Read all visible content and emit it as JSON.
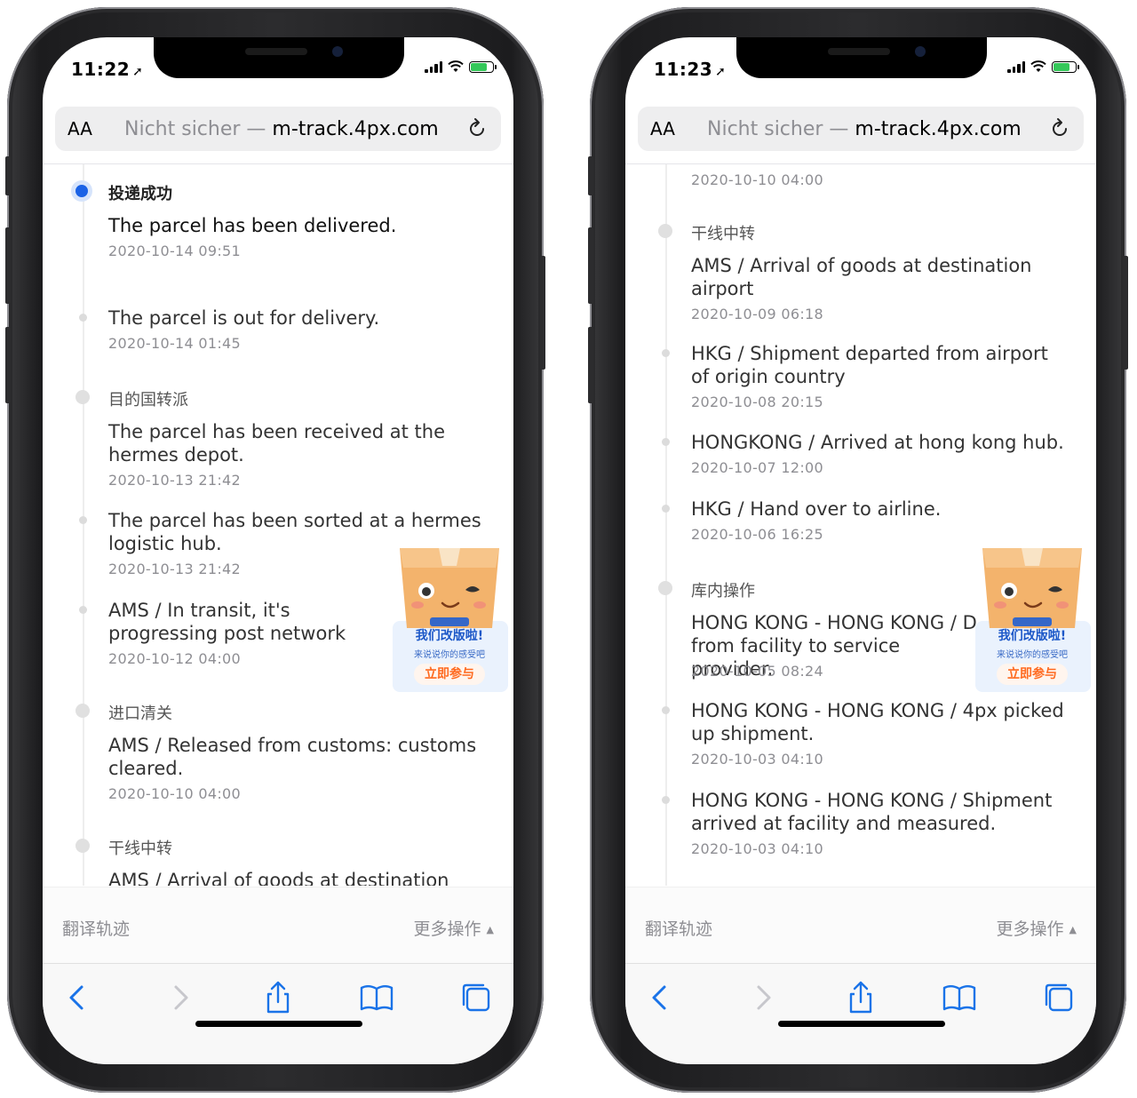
{
  "left": {
    "status_time": "11:22",
    "url_aa": "AA",
    "url_prefix": "Nicht sicher — ",
    "url_domain": "m-track.4px.com",
    "events": [
      {
        "status": "投递成功",
        "desc": "The parcel has been delivered.",
        "time": "2020-10-14 09:51",
        "dot": "active"
      },
      {
        "desc": "The parcel is out for delivery.",
        "time": "2020-10-14 01:45",
        "dot": "small"
      },
      {
        "status": "目的国转派",
        "desc": "The parcel has been received at the hermes depot.",
        "time": "2020-10-13 21:42",
        "dot": "big"
      },
      {
        "desc": "The parcel has been sorted at a hermes logistic hub.",
        "time": "2020-10-13 21:42",
        "dot": "small"
      },
      {
        "desc": "AMS / In transit, it's progressing post network",
        "time": "2020-10-12 04:00",
        "dot": "small"
      },
      {
        "status": "进口清关",
        "desc": "AMS / Released from customs: customs cleared.",
        "time": "2020-10-10 04:00",
        "dot": "big"
      },
      {
        "status": "干线中转",
        "desc": "AMS / Arrival of goods at destination airport",
        "dot": "big"
      }
    ],
    "bottom": {
      "translate": "翻译轨迹",
      "more": "更多操作"
    }
  },
  "right": {
    "status_time": "11:23",
    "url_aa": "AA",
    "url_prefix": "Nicht sicher — ",
    "url_domain": "m-track.4px.com",
    "events": [
      {
        "time": "2020-10-10 04:00"
      },
      {
        "status": "干线中转",
        "desc": "AMS / Arrival of goods at destination airport",
        "time": "2020-10-09 06:18",
        "dot": "big"
      },
      {
        "desc": "HKG / Shipment departed from airport of origin country",
        "time": "2020-10-08 20:15",
        "dot": "small"
      },
      {
        "desc": "HONGKONG / Arrived at hong kong hub.",
        "time": "2020-10-07 12:00",
        "dot": "small"
      },
      {
        "desc": "HKG / Hand over to airline.",
        "time": "2020-10-06 16:25",
        "dot": "small"
      },
      {
        "status": "库内操作",
        "desc": "HONG KONG - HONG KONG / D from facility to service provider.",
        "time": "2020-10-05 08:24",
        "dot": "big"
      },
      {
        "desc": "HONG KONG - HONG KONG / 4px picked up shipment.",
        "time": "2020-10-03 04:10",
        "dot": "small"
      },
      {
        "desc": "HONG KONG - HONG KONG / Shipment arrived at facility and measured.",
        "time": "2020-10-03 04:10",
        "dot": "small"
      }
    ],
    "bottom": {
      "translate": "翻译轨迹",
      "more": "更多操作"
    }
  },
  "mascot": {
    "headline": "我们改版啦!",
    "subline": "来说说你的感受吧",
    "cta": "立即参与"
  },
  "colors": {
    "accent": "#1a62e6",
    "cta": "#ff6a1f",
    "mascot_headline": "#1d58c8"
  },
  "icons": [
    "back-icon",
    "forward-icon",
    "share-icon",
    "bookmarks-icon",
    "tabs-icon",
    "reload-icon",
    "location-arrow-icon",
    "signal-icon",
    "wifi-icon",
    "battery-icon"
  ]
}
